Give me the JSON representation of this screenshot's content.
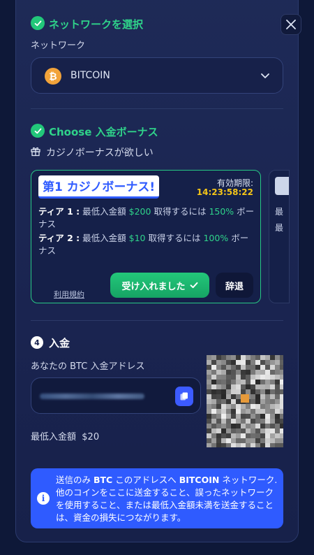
{
  "network_section": {
    "title": "ネットワークを選択",
    "label": "ネットワーク",
    "selected": "BITCOIN",
    "coin_symbol": "₿"
  },
  "bonus_section": {
    "title": "Choose 入金ボーナス",
    "want_label": "カジノボーナスが欲しい",
    "card": {
      "banner": "第1 カジノボーナス!",
      "expiry_label": "有効期限:",
      "expiry_time": "14:23:58:22",
      "tiers": [
        {
          "name": "ティア 1 :",
          "min_label": "最低入金額",
          "min_value": "$200",
          "mid": "取得するには",
          "pct": "150%",
          "tail": "ボーナス"
        },
        {
          "name": "ティア 2 :",
          "min_label": "最低入金額",
          "min_value": "$10",
          "mid": "取得するには",
          "pct": "100%",
          "tail": "ボーナス"
        }
      ],
      "terms": "利用規約",
      "accept_label": "受け入れました",
      "decline_label": "辞退"
    },
    "next_card_lines": [
      "最",
      "最"
    ]
  },
  "deposit_section": {
    "step": "4",
    "title": "入金",
    "address_label": "あなたの BTC 入金アドレス",
    "min_label": "最低入金額",
    "min_value": "$20"
  },
  "warning": {
    "part1": "送信のみ",
    "bold1": "BTC",
    "part2": "このアドレスへ",
    "bold2": "BITCOIN",
    "part3": "ネットワーク. 他のコインをここに送金すること、誤ったネットワークを使用すること、または最低入金額未満を送金することは、資金の損失につながります。"
  },
  "colors": {
    "accent_green": "#2fd38a",
    "brand_blue": "#2f5bff",
    "expiry_yellow": "#f5c518",
    "panel_bg": "#1e2a57"
  }
}
